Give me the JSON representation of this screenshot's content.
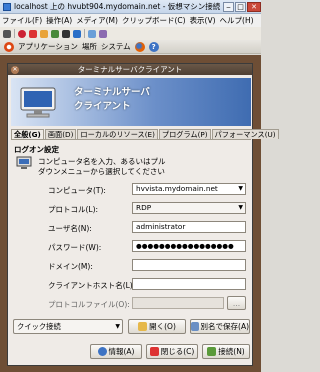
{
  "vm": {
    "title": "localhost 上の hvubt904.mydomain.net - 仮想マシン接続",
    "menu": [
      "ファイル(F)",
      "操作(A)",
      "メディア(M)",
      "クリップボード(C)",
      "表示(V)",
      "ヘルプ(H)"
    ]
  },
  "guest_panel": {
    "applications": "アプリケーション",
    "places": "場所",
    "system": "システム"
  },
  "dialog": {
    "title": "ターミナルサーバクライアント",
    "banner_line1": "ターミナルサーバ",
    "banner_line2": "クライアント",
    "tabs": [
      "全般(G)",
      "画面(D)",
      "ローカルのリソース(E)",
      "プログラム(P)",
      "パフォーマンス(U)"
    ],
    "section_title": "ログオン設定",
    "instruction_line1": "コンピュータ名を入力、あるいはプル",
    "instruction_line2": "ダウンメニューから選択してください",
    "fields": {
      "computer_label": "コンピュータ(T):",
      "computer_value": "hvvista.mydomain.net",
      "protocol_label": "プロトコル(L):",
      "protocol_value": "RDP",
      "user_label": "ユーザ名(N):",
      "user_value": "administrator",
      "password_label": "パスワード(W):",
      "password_value": "●●●●●●●●●●●●●●●●●",
      "domain_label": "ドメイン(M):",
      "domain_value": "",
      "client_host_label": "クライアントホスト名(L):",
      "client_host_value": "",
      "protocol_file_label": "プロトコルファイル(O):",
      "protocol_file_value": "",
      "browse_label": "..."
    },
    "quick_connect": "クイック接続",
    "open_button": "開く(O)",
    "save_as_button": "別名で保存(A)",
    "info_button": "情報(A)",
    "close_button": "閉じる(C)",
    "connect_button": "接続(N)"
  },
  "colors": {
    "accent": "#3f6cb1",
    "desktop": "#6e4e35"
  }
}
